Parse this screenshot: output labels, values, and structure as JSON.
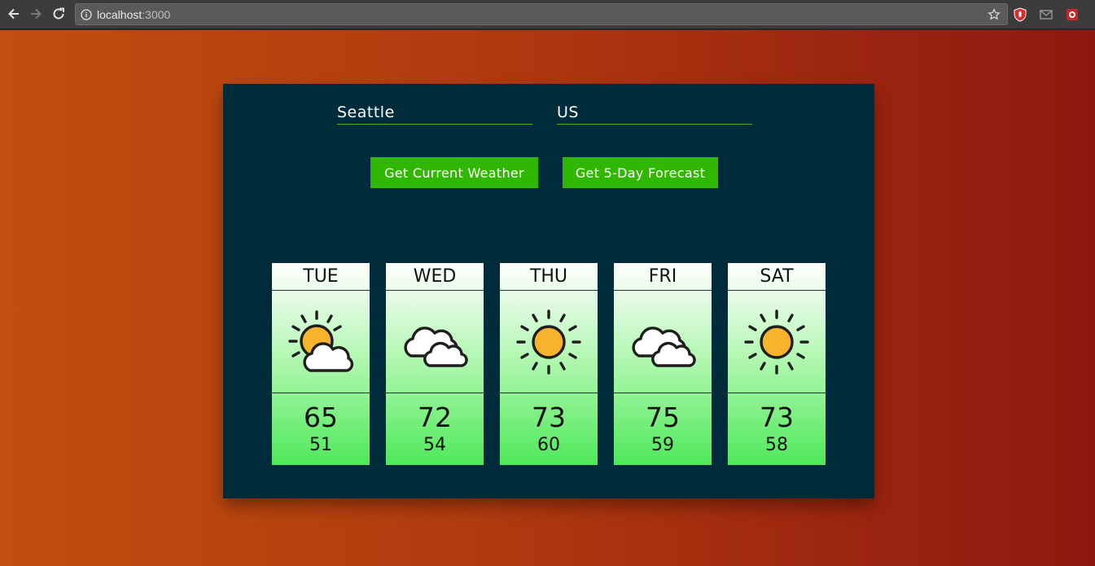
{
  "browser": {
    "url_host": "localhost",
    "url_port": ":3000"
  },
  "form": {
    "city_value": "Seattle",
    "country_value": "US"
  },
  "buttons": {
    "current_label": "Get Current Weather",
    "forecast_label": "Get 5-Day Forecast"
  },
  "forecast": [
    {
      "day": "TUE",
      "icon": "partly-sunny-icon",
      "high": "65",
      "low": "51"
    },
    {
      "day": "WED",
      "icon": "cloudy-icon",
      "high": "72",
      "low": "54"
    },
    {
      "day": "THU",
      "icon": "sunny-icon",
      "high": "73",
      "low": "60"
    },
    {
      "day": "FRI",
      "icon": "cloudy-icon",
      "high": "75",
      "low": "59"
    },
    {
      "day": "SAT",
      "icon": "sunny-icon",
      "high": "73",
      "low": "58"
    }
  ],
  "colors": {
    "accent": "#30b800",
    "card_bg": "#002b3a",
    "sun": "#f7b32b"
  }
}
